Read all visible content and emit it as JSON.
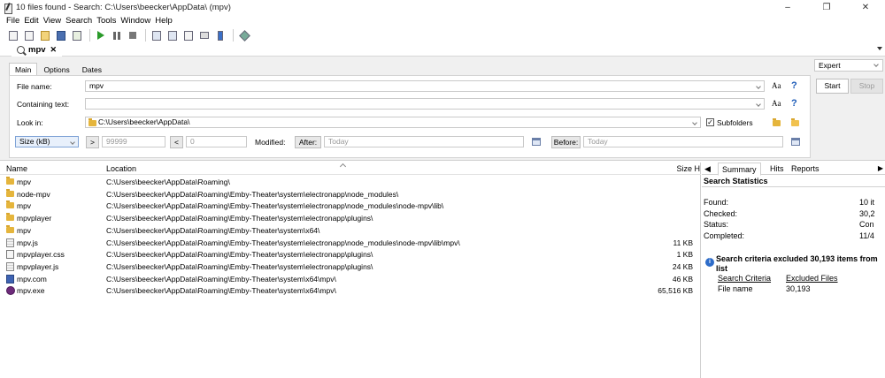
{
  "window": {
    "title": "10 files found - Search: C:\\Users\\beecker\\AppData\\ (mpv)",
    "controls": [
      "–",
      "❐",
      "✕"
    ]
  },
  "menu": [
    "File",
    "Edit",
    "View",
    "Search",
    "Tools",
    "Window",
    "Help"
  ],
  "toolbar": {
    "icons": [
      "new-search-icon",
      "copy-icon",
      "open-icon",
      "save-icon",
      "export-icon",
      "start-icon",
      "pause-icon",
      "stop-icon",
      "layout-icon",
      "view-icon",
      "properties-icon",
      "print-icon",
      "help-book-icon",
      "tools-icon"
    ]
  },
  "doc_tab": {
    "label": "mpv",
    "close": "✕"
  },
  "options_tabs": [
    "Main",
    "Options",
    "Dates"
  ],
  "form": {
    "file_name_label": "File name:",
    "file_name_value": "mpv",
    "containing_text_label": "Containing text:",
    "containing_text_value": "",
    "look_in_label": "Look in:",
    "look_in_value": "C:\\Users\\beecker\\AppData\\",
    "subfolders_label": "Subfolders",
    "subfolders_checked": "✓",
    "aa_label": "Aa",
    "help_glyph": "?",
    "size_unit": "Size (kB)",
    "gt_label": ">",
    "gt_value": "99999",
    "lt_label": "<",
    "lt_value": "0",
    "modified_label": "Modified:",
    "after_label": "After:",
    "after_value": "Today",
    "before_label": "Before:",
    "before_value": "Today"
  },
  "side_controls": {
    "mode": "Expert",
    "start": "Start",
    "stop": "Stop"
  },
  "results": {
    "headers": {
      "name": "Name",
      "location": "Location",
      "size": "Size H"
    },
    "rows": [
      {
        "name": "mpv",
        "location": "C:\\Users\\beecker\\AppData\\Roaming\\",
        "size": "",
        "icon": "folder-icon"
      },
      {
        "name": "node-mpv",
        "location": "C:\\Users\\beecker\\AppData\\Roaming\\Emby-Theater\\system\\electronapp\\node_modules\\",
        "size": "",
        "icon": "folder-icon"
      },
      {
        "name": "mpv",
        "location": "C:\\Users\\beecker\\AppData\\Roaming\\Emby-Theater\\system\\electronapp\\node_modules\\node-mpv\\lib\\",
        "size": "",
        "icon": "folder-icon"
      },
      {
        "name": "mpvplayer",
        "location": "C:\\Users\\beecker\\AppData\\Roaming\\Emby-Theater\\system\\electronapp\\plugins\\",
        "size": "",
        "icon": "folder-icon"
      },
      {
        "name": "mpv",
        "location": "C:\\Users\\beecker\\AppData\\Roaming\\Emby-Theater\\system\\x64\\",
        "size": "",
        "icon": "folder-icon"
      },
      {
        "name": "mpv.js",
        "location": "C:\\Users\\beecker\\AppData\\Roaming\\Emby-Theater\\system\\electronapp\\node_modules\\node-mpv\\lib\\mpv\\",
        "size": "11 KB",
        "icon": "js-file-icon"
      },
      {
        "name": "mpvplayer.css",
        "location": "C:\\Users\\beecker\\AppData\\Roaming\\Emby-Theater\\system\\electronapp\\plugins\\",
        "size": "1 KB",
        "icon": "css-file-icon"
      },
      {
        "name": "mpvplayer.js",
        "location": "C:\\Users\\beecker\\AppData\\Roaming\\Emby-Theater\\system\\electronapp\\plugins\\",
        "size": "24 KB",
        "icon": "js-file-icon"
      },
      {
        "name": "mpv.com",
        "location": "C:\\Users\\beecker\\AppData\\Roaming\\Emby-Theater\\system\\x64\\mpv\\",
        "size": "46 KB",
        "icon": "com-file-icon"
      },
      {
        "name": "mpv.exe",
        "location": "C:\\Users\\beecker\\AppData\\Roaming\\Emby-Theater\\system\\x64\\mpv\\",
        "size": "65,516 KB",
        "icon": "exe-file-icon"
      }
    ]
  },
  "side_panel": {
    "nav_left": "◀",
    "nav_right": "▶",
    "tabs": [
      "Summary",
      "Hits",
      "Reports"
    ],
    "title": "Search Statistics",
    "stats": [
      {
        "label": "Found:",
        "value": "10 it"
      },
      {
        "label": "Checked:",
        "value": "30,2"
      },
      {
        "label": "Status:",
        "value": "Con"
      },
      {
        "label": "Completed:",
        "value": "11/4"
      }
    ],
    "info_glyph": "i",
    "info_text": "Search criteria excluded 30,193 items from list",
    "criteria_header": "Search Criteria",
    "excluded_header": "Excluded Files",
    "criteria_value": "File name",
    "excluded_value": "30,193"
  }
}
